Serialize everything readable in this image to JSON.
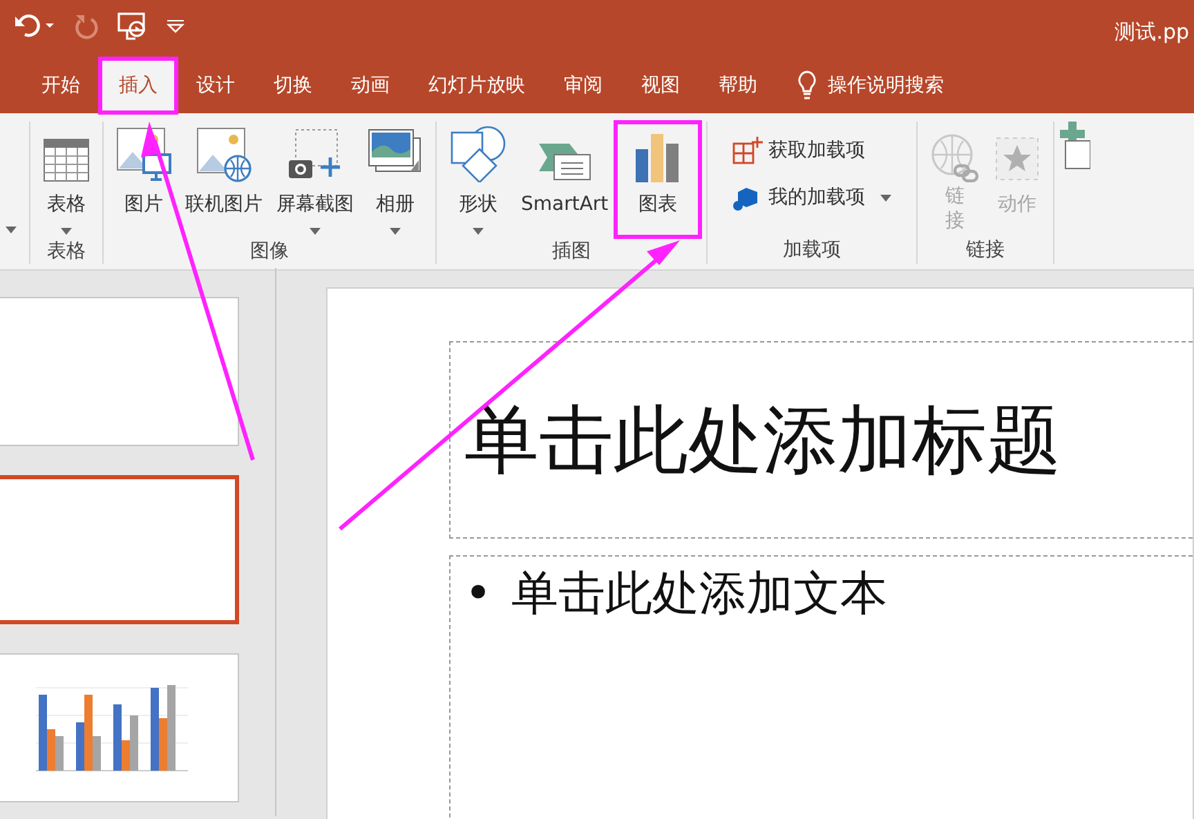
{
  "title_bar": {
    "title": "测试.pp",
    "quick_access": [
      {
        "kind": "undo",
        "disabled": false
      },
      {
        "kind": "redo",
        "disabled": true
      },
      {
        "kind": "present",
        "disabled": false
      },
      {
        "kind": "customize",
        "disabled": false
      }
    ]
  },
  "tabs": [
    {
      "label": "开始",
      "selected": false,
      "highlighted": false
    },
    {
      "label": "插入",
      "selected": true,
      "highlighted": true
    },
    {
      "label": "设计",
      "selected": false,
      "highlighted": false
    },
    {
      "label": "切换",
      "selected": false,
      "highlighted": false
    },
    {
      "label": "动画",
      "selected": false,
      "highlighted": false
    },
    {
      "label": "幻灯片放映",
      "selected": false,
      "highlighted": false
    },
    {
      "label": "审阅",
      "selected": false,
      "highlighted": false
    },
    {
      "label": "视图",
      "selected": false,
      "highlighted": false
    },
    {
      "label": "帮助",
      "selected": false,
      "highlighted": false
    }
  ],
  "search": {
    "label": "操作说明搜索"
  },
  "ribbon": {
    "groups": [
      {
        "label": "表格",
        "items": [
          {
            "kind": "table",
            "label": "表格",
            "dropdown": true,
            "disabled": false,
            "highlighted": false
          }
        ]
      },
      {
        "label": "图像",
        "items": [
          {
            "kind": "picture",
            "label": "图片",
            "dropdown": false,
            "disabled": false,
            "highlighted": false
          },
          {
            "kind": "online-picture",
            "label": "联机图片",
            "dropdown": false,
            "disabled": false,
            "highlighted": false
          },
          {
            "kind": "screenshot",
            "label": "屏幕截图",
            "dropdown": true,
            "disabled": false,
            "highlighted": false
          },
          {
            "kind": "album",
            "label": "相册",
            "dropdown": true,
            "disabled": false,
            "highlighted": false
          }
        ]
      },
      {
        "label": "插图",
        "items": [
          {
            "kind": "shapes",
            "label": "形状",
            "dropdown": true,
            "disabled": false,
            "highlighted": false
          },
          {
            "kind": "smartart",
            "label": "SmartArt",
            "dropdown": false,
            "disabled": false,
            "highlighted": false
          },
          {
            "kind": "chart",
            "label": "图表",
            "dropdown": false,
            "disabled": false,
            "highlighted": true
          }
        ]
      },
      {
        "label": "加载项",
        "items": [
          {
            "kind": "get-addins",
            "label": "获取加载项",
            "dropdown": false,
            "disabled": false,
            "highlighted": false
          },
          {
            "kind": "my-addins",
            "label": "我的加载项",
            "dropdown": true,
            "disabled": false,
            "highlighted": false
          }
        ]
      },
      {
        "label": "链接",
        "items": [
          {
            "kind": "link",
            "label": "链接",
            "dropdown": false,
            "disabled": true,
            "highlighted": false
          },
          {
            "kind": "action",
            "label": "动作",
            "dropdown": false,
            "disabled": true,
            "highlighted": false
          }
        ]
      }
    ]
  },
  "slides": [
    {
      "kind": "blank",
      "selected": false
    },
    {
      "kind": "blank",
      "selected": true
    },
    {
      "kind": "chart",
      "selected": false
    }
  ],
  "slide": {
    "title_placeholder": "单击此处添加标题",
    "body_bullet": "•",
    "body_placeholder": "单击此处添加文本"
  }
}
